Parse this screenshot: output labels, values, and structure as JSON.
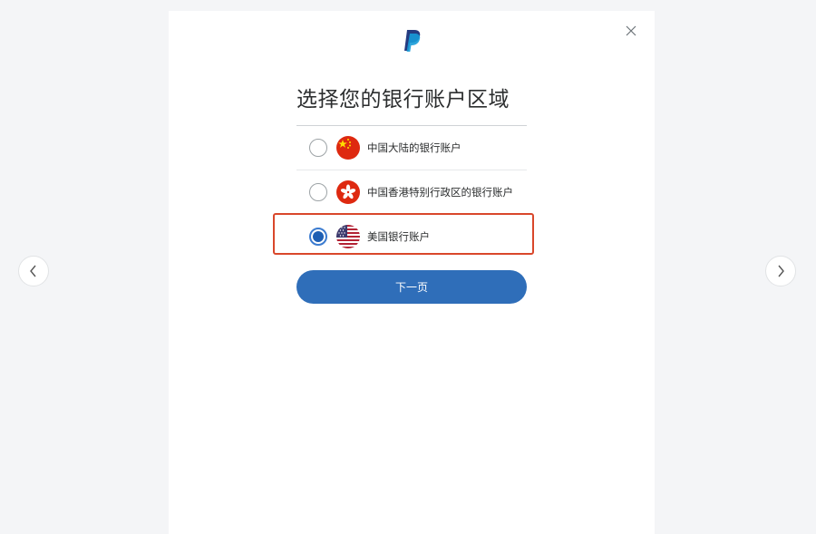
{
  "dialog": {
    "brand_icon": "paypal-logo",
    "close_icon": "close-icon",
    "title": "选择您的银行账户区域",
    "options": [
      {
        "label": "中国大陆的银行账户",
        "flag_icon": "china-flag-icon",
        "selected": false
      },
      {
        "label": "中国香港特别行政区的银行账户",
        "flag_icon": "hong-kong-flag-icon",
        "selected": false
      },
      {
        "label": "美国银行账户",
        "flag_icon": "us-flag-icon",
        "selected": true
      }
    ],
    "next_button": "下一页"
  },
  "carousel": {
    "prev_icon": "chevron-left-icon",
    "next_icon": "chevron-right-icon"
  },
  "colors": {
    "accent": "#2f6eb9",
    "highlight": "#d9472b",
    "background": "#f4f5f7"
  }
}
